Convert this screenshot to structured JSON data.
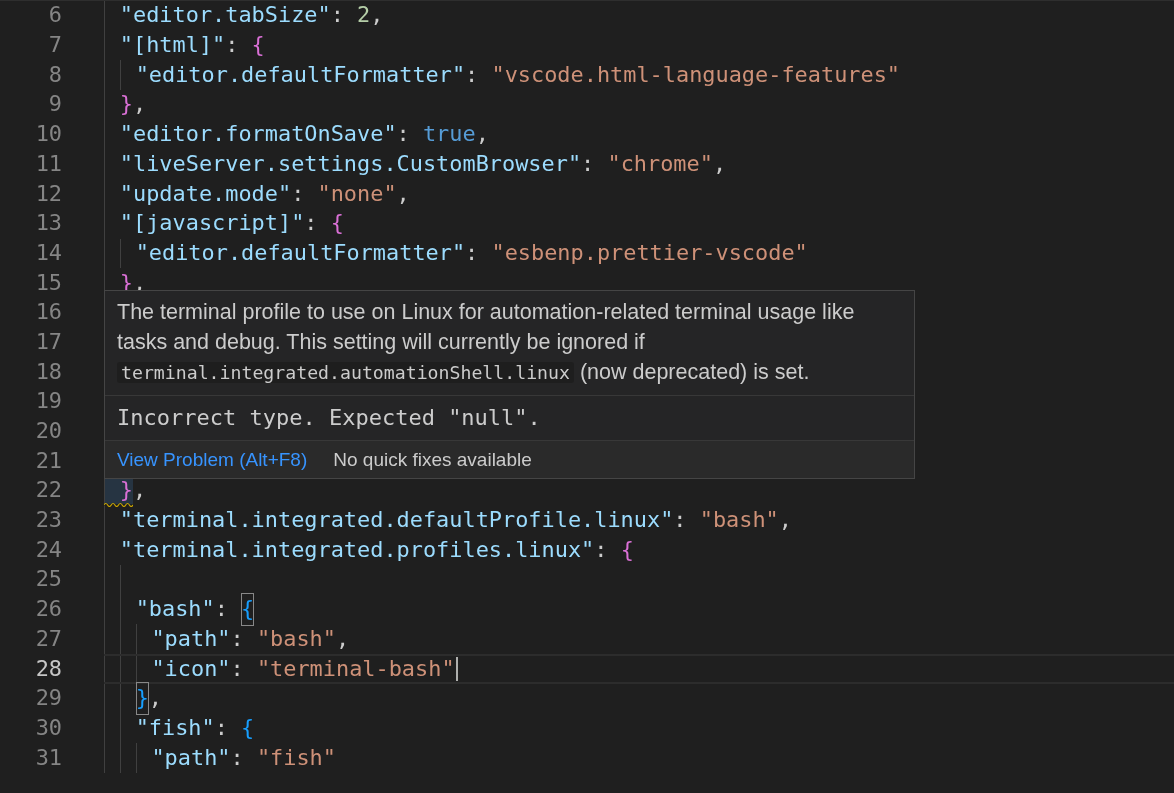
{
  "editor": {
    "lines": [
      {
        "number": "6",
        "tokens": [
          {
            "kind": "key",
            "text": "\"editor.tabSize\""
          },
          {
            "kind": "punct",
            "text": ": "
          },
          {
            "kind": "number",
            "text": "2"
          },
          {
            "kind": "punct",
            "text": ","
          }
        ]
      },
      {
        "number": "7",
        "tokens": [
          {
            "kind": "key",
            "text": "\"[html]\""
          },
          {
            "kind": "punct",
            "text": ": "
          },
          {
            "kind": "bracket",
            "text": "{",
            "color": "#da70d6"
          }
        ],
        "children": [
          {
            "number": "8",
            "tokens": [
              {
                "kind": "key",
                "text": "\"editor.defaultFormatter\""
              },
              {
                "kind": "punct",
                "text": ": "
              },
              {
                "kind": "string",
                "text": "\"vscode.html-language-features\""
              }
            ]
          }
        ]
      },
      {
        "number": "9",
        "tokens": [
          {
            "kind": "bracket",
            "text": "}",
            "color": "#da70d6"
          },
          {
            "kind": "punct",
            "text": ","
          }
        ]
      },
      {
        "number": "10",
        "tokens": [
          {
            "kind": "key",
            "text": "\"editor.formatOnSave\""
          },
          {
            "kind": "punct",
            "text": ": "
          },
          {
            "kind": "keyword",
            "text": "true"
          },
          {
            "kind": "punct",
            "text": ","
          }
        ]
      },
      {
        "number": "11",
        "tokens": [
          {
            "kind": "key",
            "text": "\"liveServer.settings.CustomBrowser\""
          },
          {
            "kind": "punct",
            "text": ": "
          },
          {
            "kind": "string",
            "text": "\"chrome\""
          },
          {
            "kind": "punct",
            "text": ","
          }
        ]
      },
      {
        "number": "12",
        "tokens": [
          {
            "kind": "key",
            "text": "\"update.mode\""
          },
          {
            "kind": "punct",
            "text": ": "
          },
          {
            "kind": "string",
            "text": "\"none\""
          },
          {
            "kind": "punct",
            "text": ","
          }
        ]
      },
      {
        "number": "13",
        "tokens": [
          {
            "kind": "key",
            "text": "\"[javascript]\""
          },
          {
            "kind": "punct",
            "text": ": "
          },
          {
            "kind": "bracket",
            "text": "{",
            "color": "#da70d6"
          }
        ],
        "children": [
          {
            "number": "14",
            "tokens": [
              {
                "kind": "key",
                "text": "\"editor.defaultFormatter\""
              },
              {
                "kind": "punct",
                "text": ": "
              },
              {
                "kind": "string",
                "text": "\"esbenp.prettier-vscode\""
              }
            ]
          }
        ]
      },
      {
        "number": "15",
        "tokens": [
          {
            "kind": "bracket",
            "text": "}",
            "color": "#da70d6"
          },
          {
            "kind": "punct",
            "text": ","
          }
        ]
      },
      {
        "number": "16"
      },
      {
        "number": "17"
      },
      {
        "number": "18"
      },
      {
        "number": "19"
      },
      {
        "number": "20"
      },
      {
        "number": "21"
      },
      {
        "number": "22",
        "problem": true,
        "tokens": [
          {
            "kind": "bracket",
            "text": "}",
            "color": "#da70d6"
          },
          {
            "kind": "punct",
            "text": ","
          }
        ]
      },
      {
        "number": "23",
        "tokens": [
          {
            "kind": "key",
            "text": "\"terminal.integrated.defaultProfile.linux\""
          },
          {
            "kind": "punct",
            "text": ": "
          },
          {
            "kind": "string",
            "text": "\"bash\""
          },
          {
            "kind": "punct",
            "text": ","
          }
        ]
      },
      {
        "number": "24",
        "tokens": [
          {
            "kind": "key",
            "text": "\"terminal.integrated.profiles.linux\""
          },
          {
            "kind": "punct",
            "text": ": "
          },
          {
            "kind": "bracket",
            "text": "{",
            "color": "#da70d6"
          }
        ],
        "children": [
          {
            "number": "25"
          },
          {
            "number": "26",
            "tokens": [
              {
                "kind": "key",
                "text": "\"bash\""
              },
              {
                "kind": "punct",
                "text": ": "
              },
              {
                "kind": "bracket",
                "text": "{",
                "color": "#179fff",
                "matched": true
              }
            ],
            "children": [
              {
                "number": "27",
                "tokens": [
                  {
                    "kind": "key",
                    "text": "\"path\""
                  },
                  {
                    "kind": "punct",
                    "text": ": "
                  },
                  {
                    "kind": "string",
                    "text": "\"bash\""
                  },
                  {
                    "kind": "punct",
                    "text": ","
                  }
                ]
              },
              {
                "number": "28",
                "current": true,
                "tokens": [
                  {
                    "kind": "key",
                    "text": "\"icon\""
                  },
                  {
                    "kind": "punct",
                    "text": ": "
                  },
                  {
                    "kind": "string",
                    "text": "\"terminal-bash\""
                  }
                ]
              }
            ]
          },
          {
            "number": "29",
            "tokens": [
              {
                "kind": "bracket",
                "text": "}",
                "color": "#179fff",
                "matched": true
              },
              {
                "kind": "punct",
                "text": ","
              }
            ]
          },
          {
            "number": "30",
            "tokens": [
              {
                "kind": "key",
                "text": "\"fish\""
              },
              {
                "kind": "punct",
                "text": ": "
              },
              {
                "kind": "bracket",
                "text": "{",
                "color": "#179fff"
              }
            ],
            "children": [
              {
                "number": "31",
                "tokens": [
                  {
                    "kind": "key",
                    "text": "\"path\""
                  },
                  {
                    "kind": "punct",
                    "text": ": "
                  },
                  {
                    "kind": "string",
                    "text": "\"fish\""
                  }
                ]
              }
            ]
          }
        ]
      }
    ]
  },
  "hover": {
    "description_before": "The terminal profile to use on Linux for automation-related terminal usage like tasks and debug. This setting will currently be ignored if ",
    "description_code": "terminal.integrated.automationShell.linux",
    "description_after": " (now deprecated) is set.",
    "error": "Incorrect type. Expected \"null\".",
    "view_problem": "View Problem (Alt+F8)",
    "quick_fix_status": "No quick fixes available"
  }
}
